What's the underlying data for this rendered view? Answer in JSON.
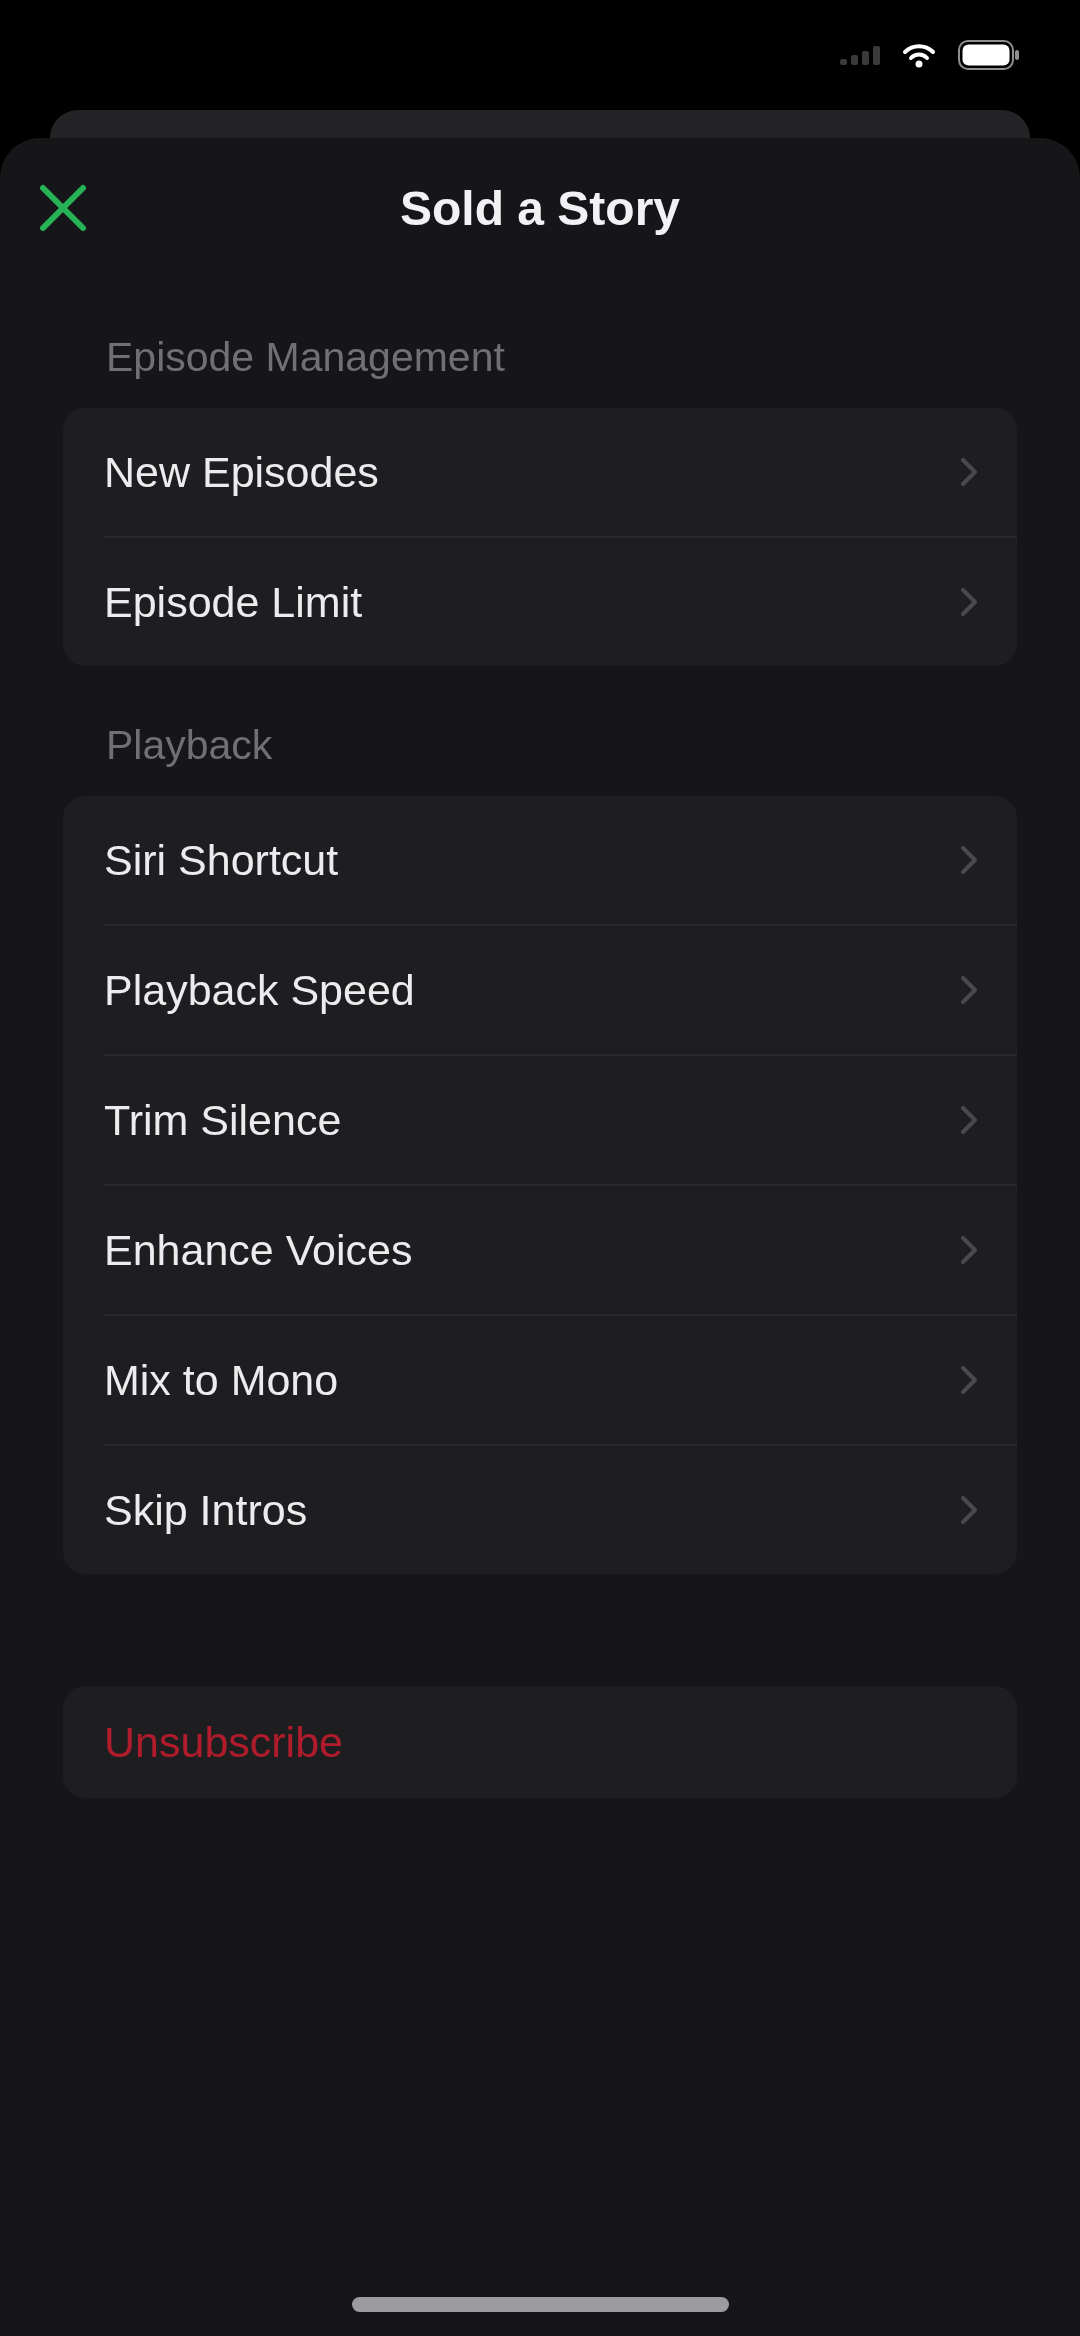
{
  "sheet": {
    "title": "Sold a Story"
  },
  "sections": [
    {
      "header": "Episode Management",
      "items": [
        {
          "label": "New Episodes",
          "kind": "link"
        },
        {
          "label": "Episode Limit",
          "kind": "link"
        }
      ]
    },
    {
      "header": "Playback",
      "items": [
        {
          "label": "Siri Shortcut",
          "kind": "link"
        },
        {
          "label": "Playback Speed",
          "kind": "link"
        },
        {
          "label": "Trim Silence",
          "kind": "link"
        },
        {
          "label": "Enhance Voices",
          "kind": "link"
        },
        {
          "label": "Mix to Mono",
          "kind": "link"
        },
        {
          "label": "Skip Intros",
          "kind": "link"
        }
      ]
    },
    {
      "items": [
        {
          "label": "Unsubscribe",
          "kind": "destructive"
        }
      ]
    }
  ]
}
